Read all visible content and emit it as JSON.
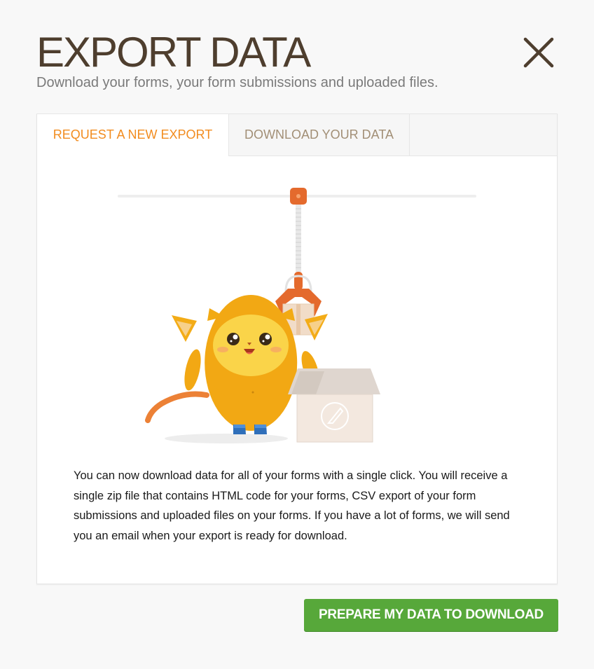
{
  "header": {
    "title": "EXPORT DATA",
    "subtitle": "Download your forms, your form submissions and uploaded files.",
    "close_icon": "close-icon"
  },
  "tabs": [
    {
      "label": "REQUEST A NEW EXPORT",
      "active": true
    },
    {
      "label": "DOWNLOAD YOUR DATA",
      "active": false
    }
  ],
  "content": {
    "description": "You can now download data for all of your forms with a single click. You will receive a single zip file that contains HTML code for your forms, CSV export of your form submissions and uploaded files on your forms. If you have a lot of forms, we will send you an email when your export is ready for download."
  },
  "actions": {
    "primary_label": "PREPARE MY DATA TO DOWNLOAD"
  },
  "colors": {
    "accent_orange": "#f28c1f",
    "button_green": "#57a83a",
    "title_brown": "#4e3e2e"
  }
}
